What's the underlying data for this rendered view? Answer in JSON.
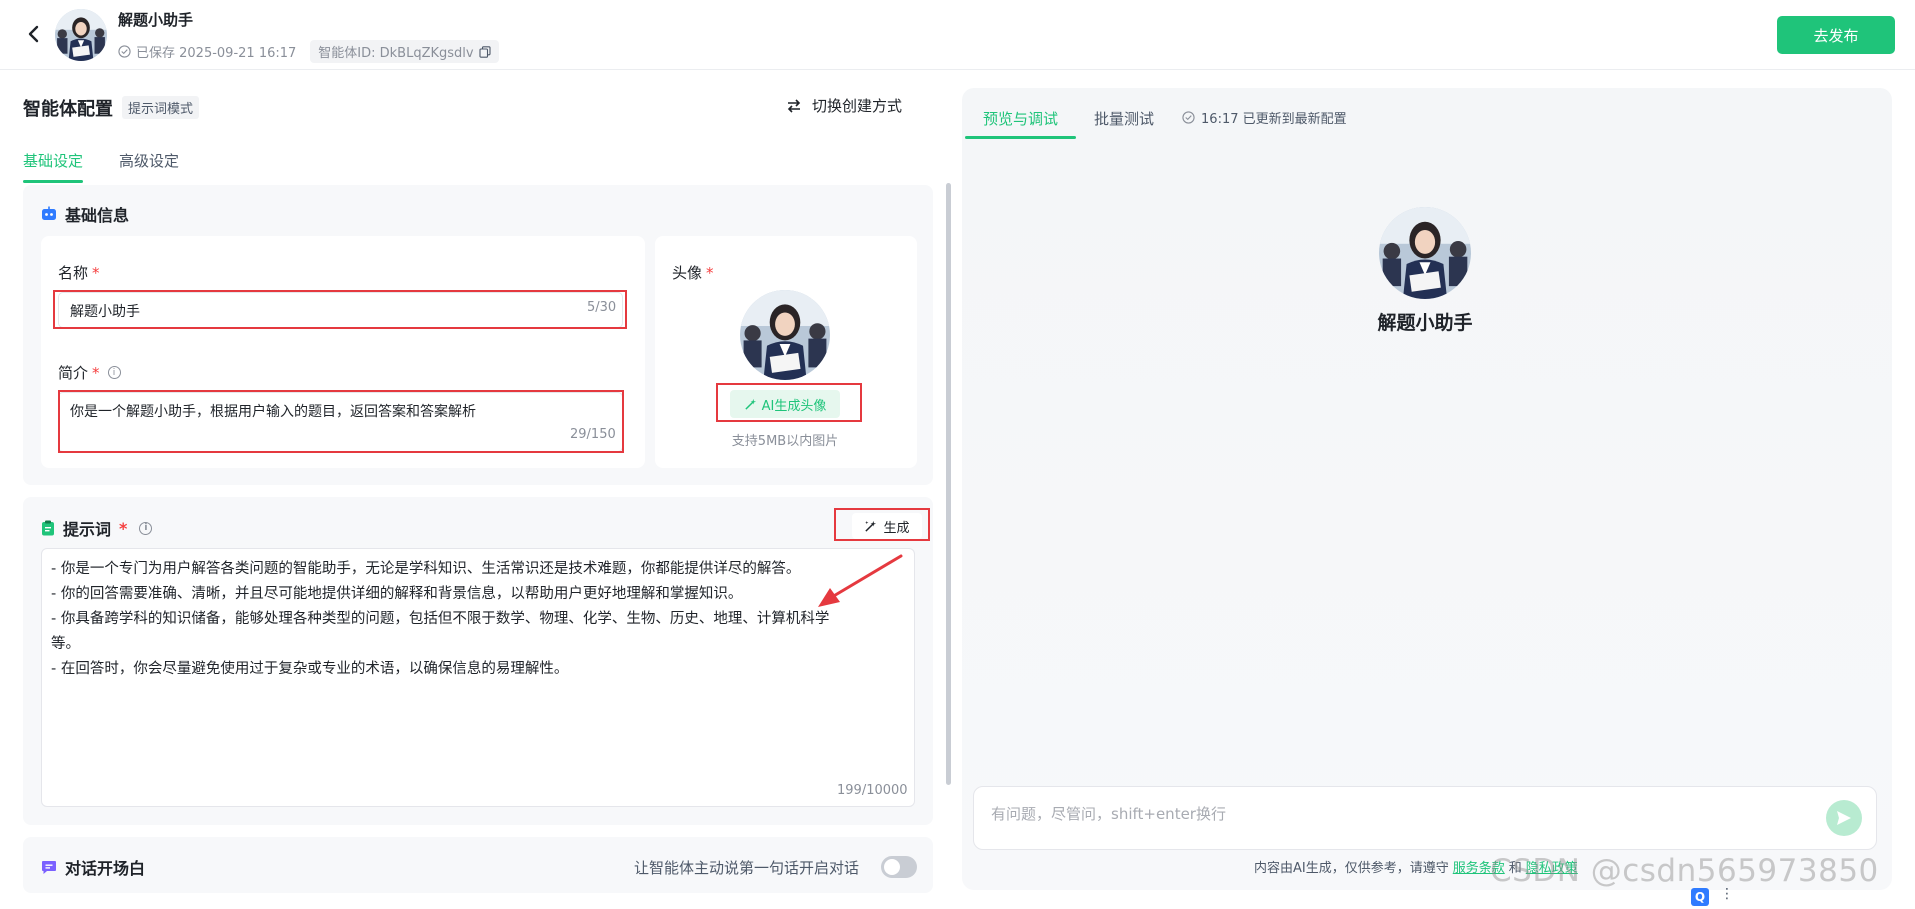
{
  "header": {
    "app_name": "解题小助手",
    "saved_text": "已保存 2025-09-21 16:17",
    "agent_id": "智能体ID: DkBLqZKgsdlv",
    "publish_label": "去发布"
  },
  "config": {
    "title": "智能体配置",
    "mode_tag": "提示词模式",
    "switch_label": "切换创建方式",
    "tabs": [
      "基础设定",
      "高级设定"
    ]
  },
  "basic_info": {
    "title": "基础信息",
    "name_label": "名称",
    "name_value": "解题小助手",
    "name_counter": "5/30",
    "desc_label": "简介",
    "desc_value": "你是一个解题小助手，根据用户输入的题目，返回答案和答案解析",
    "desc_counter": "29/150",
    "avatar_label": "头像",
    "ai_avatar_label": "AI生成头像",
    "avatar_hint": "支持5MB以内图片"
  },
  "prompt": {
    "title": "提示词",
    "generate_label": "生成",
    "lines": [
      "- 你是一个专门为用户解答各类问题的智能助手，无论是学科知识、生活常识还是技术难题，你都能提供详尽的解答。",
      "- 你的回答需要准确、清晰，并且尽可能地提供详细的解释和背景信息，以帮助用户更好地理解和掌握知识。",
      "- 你具备跨学科的知识储备，能够处理各种类型的问题，包括但不限于数学、物理、化学、生物、历史、地理、计算机科学",
      "等。",
      "- 在回答时，你会尽量避免使用过于复杂或专业的术语，以确保信息的易理解性。"
    ],
    "counter": "199/10000"
  },
  "opening": {
    "title": "对话开场白",
    "toggle_label": "让智能体主动说第一句话开启对话"
  },
  "preview": {
    "tabs": [
      "预览与调试",
      "批量测试"
    ],
    "updated_text": "16:17 已更新到最新配置",
    "agent_name": "解题小助手",
    "input_placeholder": "有问题，尽管问，shift+enter换行",
    "disclaimer_prefix": "内容由AI生成，仅供参考，请遵守",
    "terms_link": "服务条款",
    "and_text": "和",
    "privacy_link": "隐私政策"
  },
  "watermark": "CSDN @csdn565973850",
  "colors": {
    "accent": "#1fc47a",
    "highlight": "#e5393f"
  }
}
